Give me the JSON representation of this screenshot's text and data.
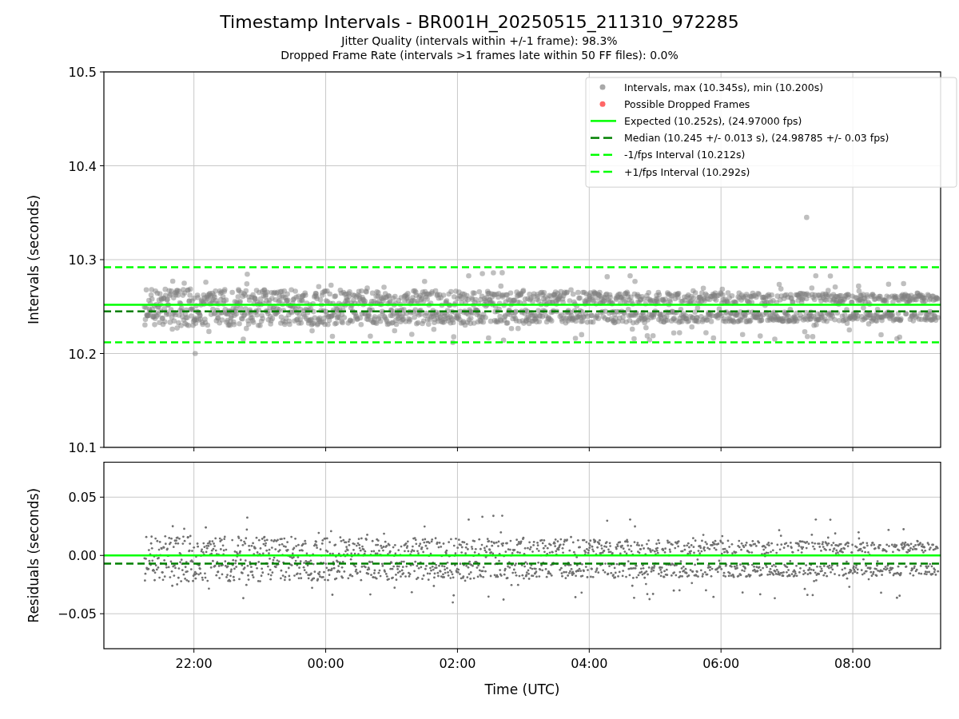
{
  "figure": {
    "title": "Timestamp Intervals - BR001H_20250515_211310_972285",
    "subtitles": [
      "Jitter Quality (intervals within +/-1 frame): 98.3%",
      "Dropped Frame Rate (intervals >1 frames late within 50 FF files): 0.0%"
    ]
  },
  "intervals_chart": {
    "legend_markers": [
      {
        "label": "Intervals, max (10.345s), min (10.200s)",
        "color": "#a8a8a8"
      },
      {
        "label": "Possible Dropped Frames",
        "color": "#ff6666"
      }
    ],
    "chart_data": {
      "type": "line",
      "ylabel": "Intervals (seconds)",
      "x": [
        "2025-05-15T20:38:00Z",
        "2025-05-16T09:20:00Z"
      ],
      "xlim": [
        "2025-05-15T20:38:00Z",
        "2025-05-16T09:20:00Z"
      ],
      "ylim": [
        10.1,
        10.5
      ],
      "yticks": [
        10.1,
        10.2,
        10.3,
        10.4,
        10.5
      ],
      "grid": true,
      "legend": "upper right",
      "series": [
        {
          "name": "Expected (10.252s), (24.97000 fps)",
          "color": "#00ff00",
          "line_style": "solid",
          "values": [
            10.252,
            10.252
          ]
        },
        {
          "name": "Median (10.245 +/- 0.013 s), (24.98785 +/- 0.03 fps)",
          "color": "#008000",
          "line_style": "dashed",
          "values": [
            10.245,
            10.245
          ]
        },
        {
          "name": "-1/fps Interval (10.212s)",
          "color": "#00ff00",
          "line_style": "dashed",
          "values": [
            10.212,
            10.212
          ]
        },
        {
          "name": "+1/fps Interval (10.292s)",
          "color": "#00ff00",
          "line_style": "dashed",
          "values": [
            10.292,
            10.292
          ]
        }
      ]
    }
  },
  "residuals_chart": {
    "chart_data": {
      "type": "line",
      "xlabel": "Time (UTC)",
      "ylabel": "Residuals (seconds)",
      "x": [
        "2025-05-15T20:38:00Z",
        "2025-05-16T09:20:00Z"
      ],
      "xlim": [
        "2025-05-15T20:38:00Z",
        "2025-05-16T09:20:00Z"
      ],
      "ylim": [
        -0.08,
        0.08
      ],
      "grid": true,
      "xticks": [
        {
          "value": "2025-05-15T22:00:00Z",
          "label": "22:00"
        },
        {
          "value": "2025-05-16T00:00:00Z",
          "label": "00:00"
        },
        {
          "value": "2025-05-16T02:00:00Z",
          "label": "02:00"
        },
        {
          "value": "2025-05-16T04:00:00Z",
          "label": "04:00"
        },
        {
          "value": "2025-05-16T06:00:00Z",
          "label": "06:00"
        },
        {
          "value": "2025-05-16T08:00:00Z",
          "label": "08:00"
        }
      ],
      "yticks": [
        {
          "value": -0.05,
          "label": "−0.05"
        },
        {
          "value": 0,
          "label": "0.00"
        },
        {
          "value": 0.05,
          "label": "0.05"
        }
      ],
      "series": [
        {
          "color": "#00ff00",
          "line_style": "solid",
          "values": [
            0,
            0
          ]
        },
        {
          "color": "#008000",
          "line_style": "dashed",
          "values": [
            -0.007,
            -0.007
          ]
        }
      ]
    }
  }
}
